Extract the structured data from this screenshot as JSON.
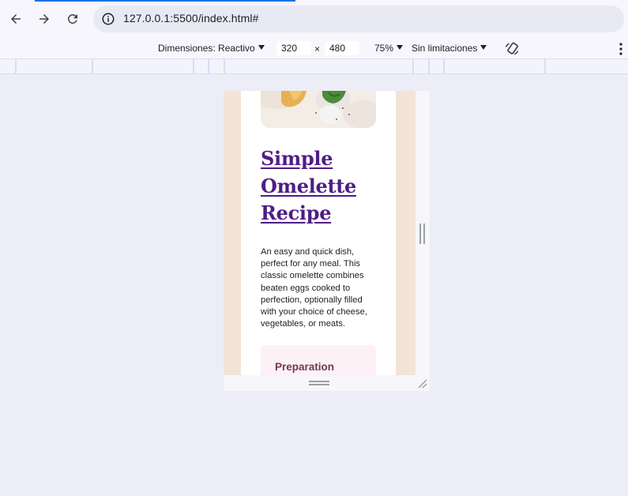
{
  "browser": {
    "url": "127.0.0.1:5500/index.html#",
    "back_icon": "arrow-left-icon",
    "forward_icon": "arrow-right-icon",
    "reload_icon": "reload-icon",
    "info_icon": "info-icon"
  },
  "device_toolbar": {
    "dimensions_label": "Dimensiones: Reactivo",
    "width_value": "320",
    "times_symbol": "×",
    "height_value": "480",
    "zoom_label": "75%",
    "throttle_label": "Sin limitaciones",
    "rotate_icon": "rotate-icon",
    "more_icon": "kebab-menu-icon"
  },
  "page": {
    "title_lines": [
      "Simple",
      "Omelette",
      "Recipe"
    ],
    "description": "An easy and quick dish, perfect for any meal. This classic omelette combines beaten eggs cooked to perfection, optionally filled with your choice of cheese, vegetables, or meats.",
    "preparation_heading": "Preparation"
  },
  "colors": {
    "title": "#4f1d86",
    "page_bg": "#f3e4d8",
    "prep_bg": "#fdf1f6",
    "prep_text": "#6e3a4f",
    "accent": "#1a73e8"
  }
}
